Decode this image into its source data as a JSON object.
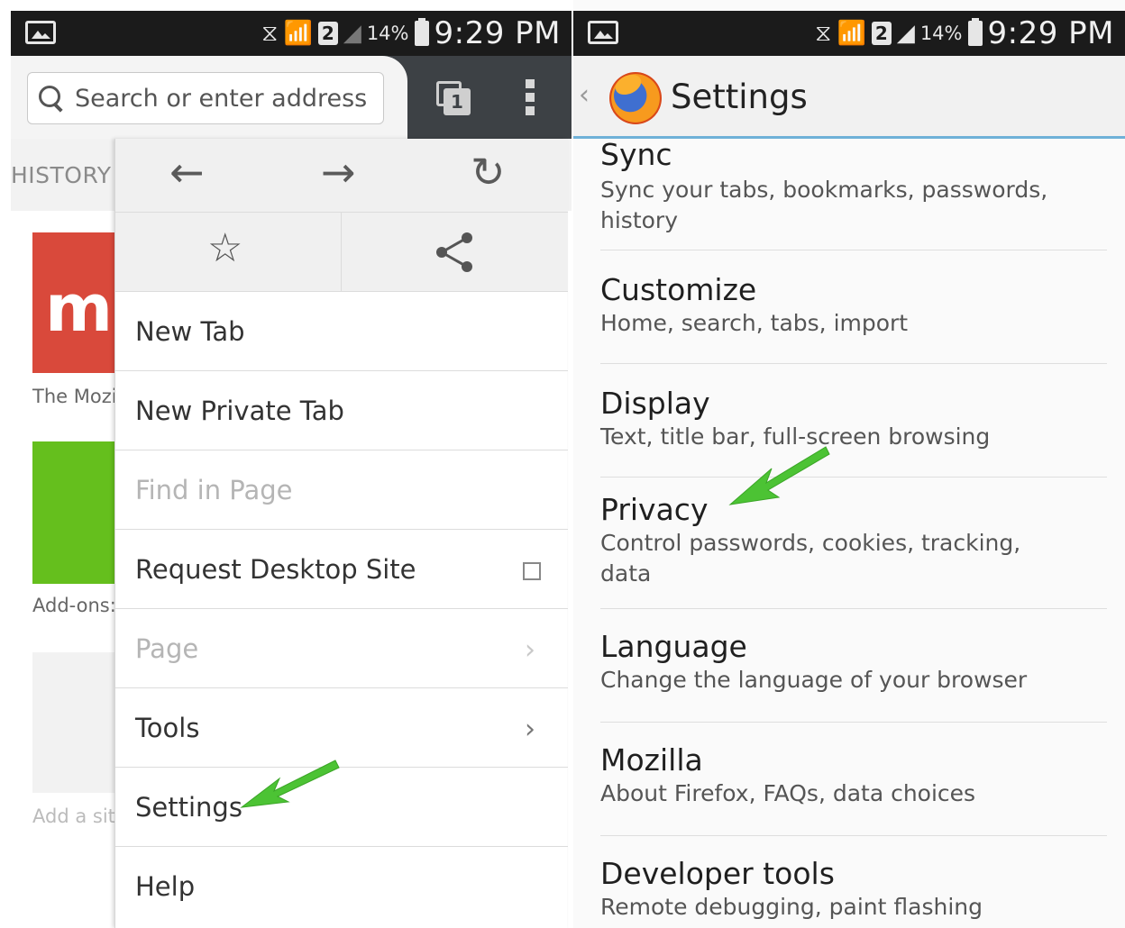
{
  "status_bar": {
    "battery": "14%",
    "time": "9:29 PM",
    "sim_label": "2"
  },
  "browser": {
    "search": {
      "placeholder": "Search or enter address"
    },
    "tab_count": "1",
    "behind": {
      "history_label": "HISTORY",
      "tile1_text": "m",
      "tile1_caption": "The Mozi",
      "tile2_caption": "Add-ons:",
      "tile3_caption": "Add a sit"
    },
    "menu": {
      "items": [
        {
          "label": "New Tab",
          "enabled": true
        },
        {
          "label": "New Private Tab",
          "enabled": true
        },
        {
          "label": "Find in Page",
          "enabled": false
        },
        {
          "label": "Request Desktop Site",
          "enabled": true,
          "checkbox": false
        },
        {
          "label": "Page",
          "enabled": false,
          "submenu": true
        },
        {
          "label": "Tools",
          "enabled": true,
          "submenu": true
        },
        {
          "label": "Settings",
          "enabled": true
        },
        {
          "label": "Help",
          "enabled": true
        }
      ]
    }
  },
  "settings": {
    "title": "Settings",
    "items": [
      {
        "title": "Sync",
        "subtitle": "Sync your tabs, bookmarks, passwords, history"
      },
      {
        "title": "Customize",
        "subtitle": "Home, search, tabs, import"
      },
      {
        "title": "Display",
        "subtitle": "Text, title bar, full-screen browsing"
      },
      {
        "title": "Privacy",
        "subtitle": "Control passwords, cookies, tracking, data"
      },
      {
        "title": "Language",
        "subtitle": "Change the language of your browser"
      },
      {
        "title": "Mozilla",
        "subtitle": "About Firefox, FAQs, data choices"
      },
      {
        "title": "Developer tools",
        "subtitle": "Remote debugging, paint flashing"
      }
    ]
  },
  "colors": {
    "accent_green_arrow": "#4cc334",
    "header_blue_line": "#6fb1d8",
    "tile_red": "#d9493b",
    "tile_green": "#65bf1d"
  }
}
